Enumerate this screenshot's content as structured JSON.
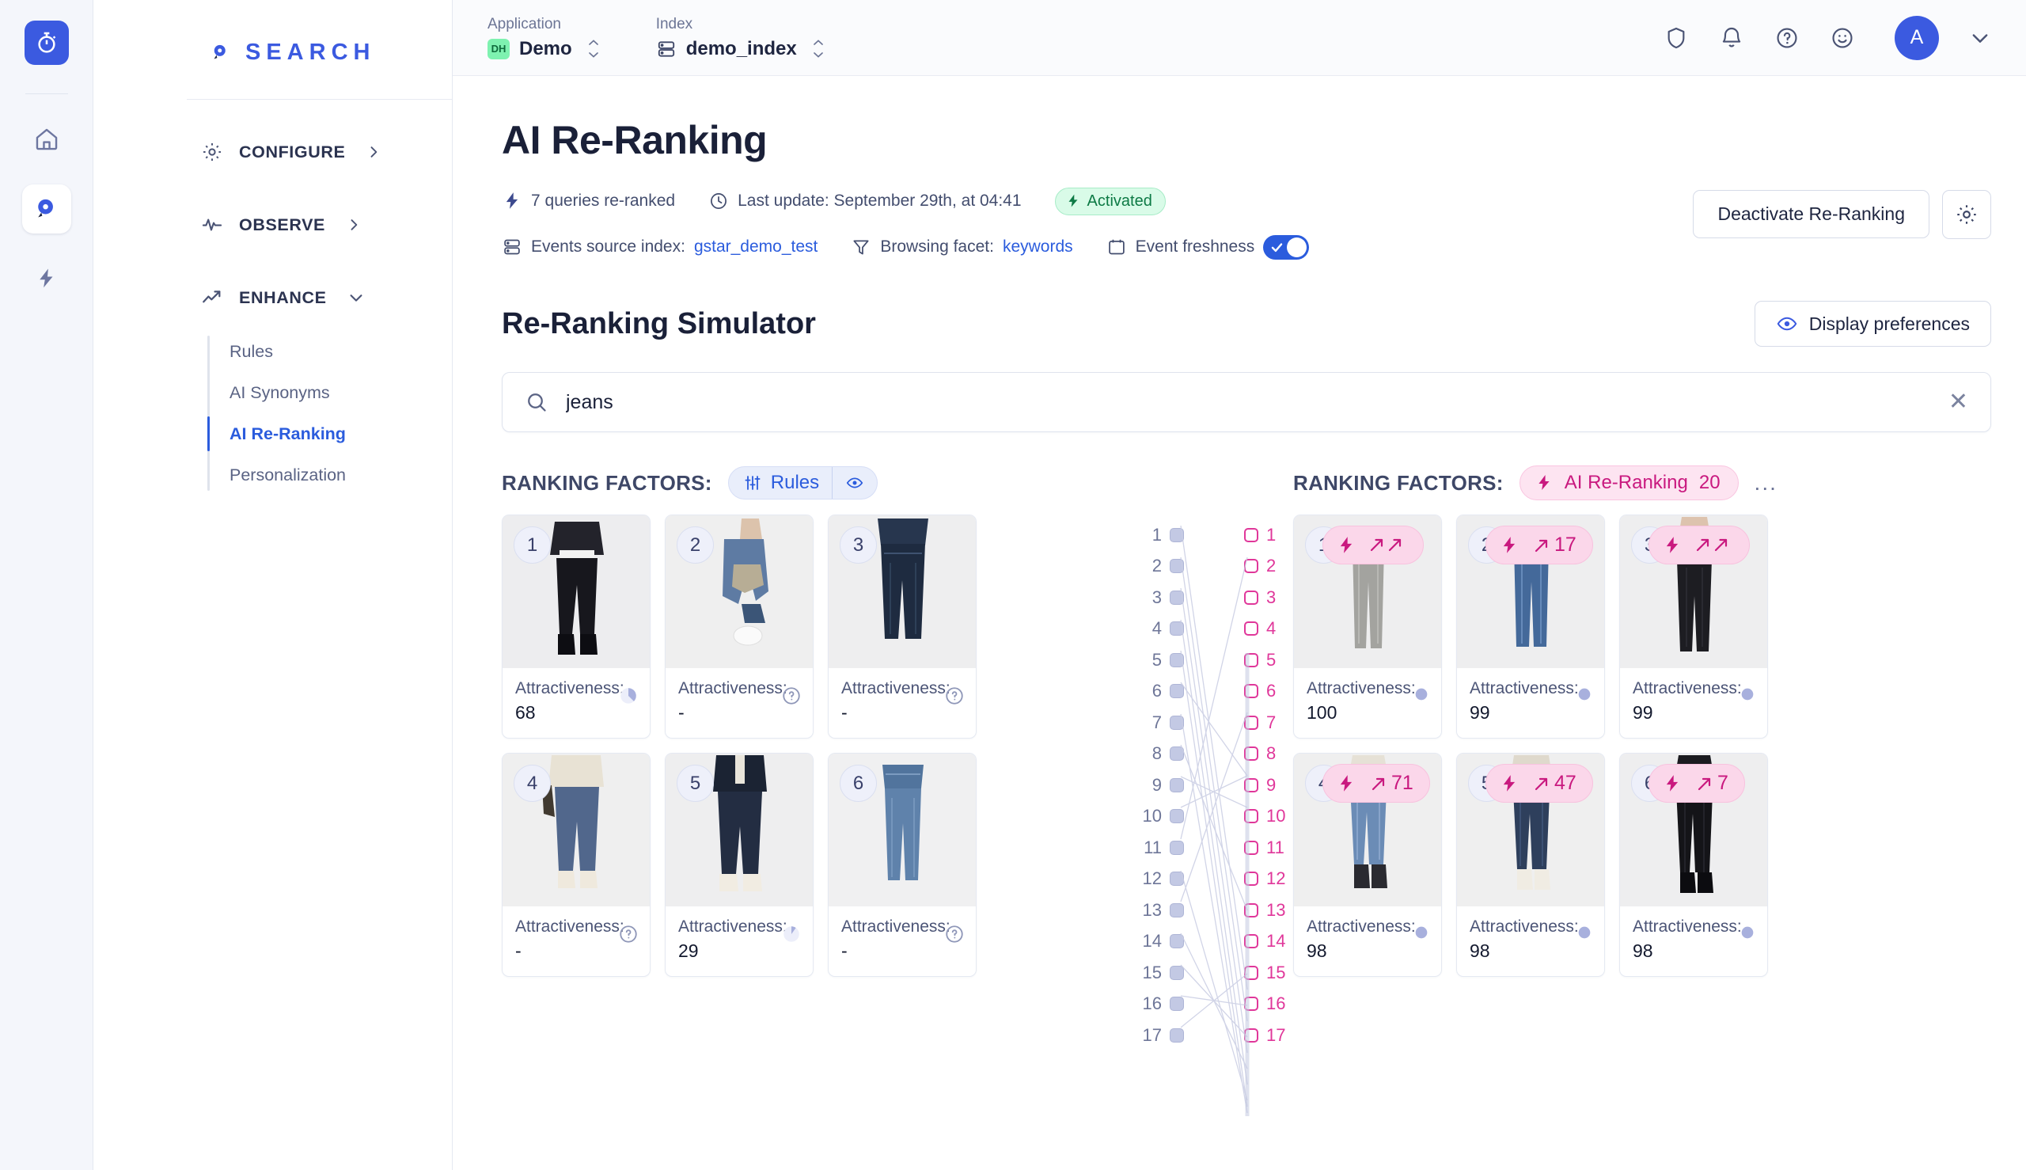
{
  "rail": {
    "logo_icon": "stopwatch-icon",
    "items": [
      {
        "icon": "home-icon",
        "name": "home"
      },
      {
        "icon": "search-pin-icon",
        "name": "search",
        "active": true
      },
      {
        "icon": "bolt-icon",
        "name": "automation"
      }
    ]
  },
  "brand": {
    "text": "SEARCH",
    "icon": "search-pin-icon"
  },
  "sidebar": {
    "groups": [
      {
        "label": "CONFIGURE",
        "icon": "gear-icon",
        "chevron": "chevron-right-icon",
        "expanded": false
      },
      {
        "label": "OBSERVE",
        "icon": "pulse-icon",
        "chevron": "chevron-right-icon",
        "expanded": false
      },
      {
        "label": "ENHANCE",
        "icon": "trend-up-icon",
        "chevron": "chevron-down-icon",
        "expanded": true
      }
    ],
    "enhance_items": [
      {
        "label": "Rules",
        "active": false
      },
      {
        "label": "AI Synonyms",
        "active": false
      },
      {
        "label": "AI Re-Ranking",
        "active": true
      },
      {
        "label": "Personalization",
        "active": false
      }
    ]
  },
  "topbar": {
    "application_label": "Application",
    "application_value": "Demo",
    "application_badge": "DH",
    "index_label": "Index",
    "index_value": "demo_index",
    "icons": [
      "shield-icon",
      "bell-icon",
      "help-circle-icon",
      "smiley-icon"
    ],
    "avatar_initial": "A",
    "avatar_chevron": "chevron-down-icon"
  },
  "page": {
    "title": "AI Re-Ranking",
    "meta": {
      "queries_reranked": "7 queries re-ranked",
      "last_update": "Last update: September 29th, at 04:41",
      "status_badge": "Activated",
      "events_source_label": "Events source index:",
      "events_source_value": "gstar_demo_test",
      "browsing_facet_label": "Browsing facet:",
      "browsing_facet_value": "keywords",
      "event_freshness_label": "Event freshness",
      "event_freshness_on": true
    },
    "deactivate_button": "Deactivate Re-Ranking",
    "settings_icon": "gear-icon"
  },
  "simulator": {
    "title": "Re-Ranking Simulator",
    "display_preferences_button": "Display preferences",
    "display_preferences_icon": "eye-icon",
    "search_value": "jeans",
    "search_placeholder": "",
    "search_icon": "search-icon",
    "clear_icon": "close-icon"
  },
  "factors": {
    "left_label": "RANKING FACTORS:",
    "left_chip": "Rules",
    "left_chip_icon": "sliders-icon",
    "left_chip_eye_icon": "eye-icon",
    "right_label": "RANKING FACTORS:",
    "right_chip": "AI Re-Ranking",
    "right_chip_count": "20",
    "right_chip_icon": "bolt-icon",
    "right_more": "..."
  },
  "colors": {
    "accent_blue": "#2b5cdd",
    "accent_pink": "#c9197f",
    "pink_light": "#fbd7ea",
    "green_badge": "#d9fbe8",
    "green_text": "#0d7a45"
  },
  "left_results": {
    "attractiveness_label": "Attractiveness:",
    "cards": [
      {
        "rank": "1",
        "attractiveness": "68",
        "marker": "pie-icon",
        "img": "man-black-jeans"
      },
      {
        "rank": "2",
        "attractiveness": "-",
        "marker": "question-icon",
        "img": "woman-light-jeans"
      },
      {
        "rank": "3",
        "attractiveness": "-",
        "marker": "question-icon",
        "img": "dark-denim-flat"
      },
      {
        "rank": "4",
        "attractiveness": "-",
        "marker": "question-icon",
        "img": "man-blue-jeans"
      },
      {
        "rank": "5",
        "attractiveness": "29",
        "marker": "pie-icon",
        "img": "man-dark-jeans"
      },
      {
        "rank": "6",
        "attractiveness": "-",
        "marker": "question-icon",
        "img": "blue-denim-flat"
      }
    ]
  },
  "right_results": {
    "attractiveness_label": "Attractiveness:",
    "cards": [
      {
        "rank": "1",
        "badge_icon": "bolt-icon",
        "delta": "",
        "delta_icon": "double-arrow-up-icon",
        "attractiveness": "100",
        "marker": "dot-icon",
        "img": "grey-jeans-flat"
      },
      {
        "rank": "2",
        "badge_icon": "bolt-icon",
        "delta": "17",
        "delta_icon": "arrow-up-right-icon",
        "attractiveness": "99",
        "marker": "dot-icon",
        "img": "blue-jeans-flat"
      },
      {
        "rank": "3",
        "badge_icon": "bolt-icon",
        "delta": "",
        "delta_icon": "double-arrow-up-icon",
        "attractiveness": "99",
        "marker": "dot-icon",
        "img": "woman-black-jeans"
      },
      {
        "rank": "4",
        "badge_icon": "bolt-icon",
        "delta": "71",
        "delta_icon": "arrow-up-right-icon",
        "attractiveness": "98",
        "marker": "dot-icon",
        "img": "woman-blue-jeans"
      },
      {
        "rank": "5",
        "badge_icon": "bolt-icon",
        "delta": "47",
        "delta_icon": "arrow-up-right-icon",
        "attractiveness": "98",
        "marker": "dot-icon",
        "img": "man-navy-jeans"
      },
      {
        "rank": "6",
        "badge_icon": "bolt-icon",
        "delta": "7",
        "delta_icon": "arrow-up-right-icon",
        "attractiveness": "98",
        "marker": "dot-icon",
        "img": "woman-black-legs"
      }
    ]
  },
  "comparison": {
    "left_positions": [
      "1",
      "2",
      "3",
      "4",
      "5",
      "6",
      "7",
      "8",
      "9",
      "10",
      "11",
      "12",
      "13",
      "14",
      "15",
      "16",
      "17"
    ],
    "right_positions": [
      "1",
      "2",
      "3",
      "4",
      "5",
      "6",
      "7",
      "8",
      "9",
      "10",
      "11",
      "12",
      "13",
      "14",
      "15",
      "16",
      "17"
    ]
  }
}
